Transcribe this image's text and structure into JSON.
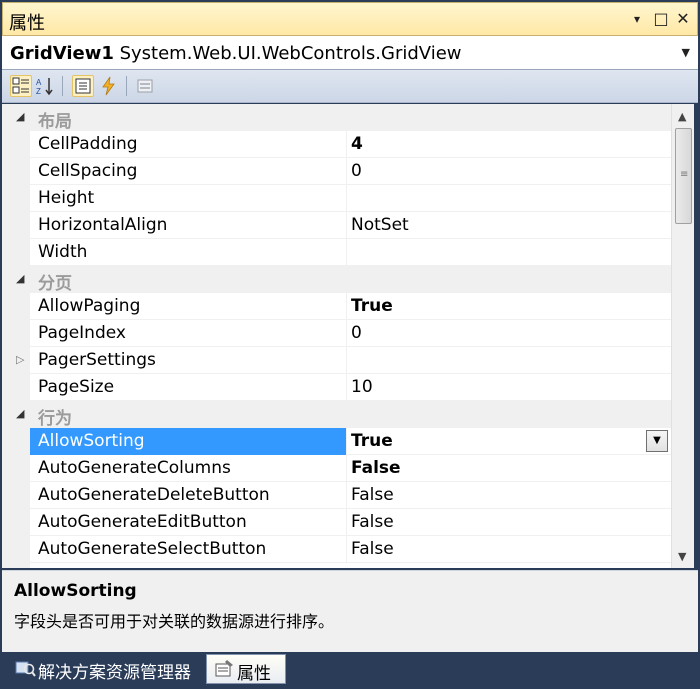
{
  "titlebar": {
    "title": "属性",
    "buttons": {
      "menu": "▾",
      "maximize": "□",
      "close": "✕"
    }
  },
  "object_selector": {
    "name": "GridView1",
    "type": "System.Web.UI.WebControls.GridView"
  },
  "toolbar": {
    "tools": [
      "categorized-icon",
      "alphabetical-icon",
      "properties-icon",
      "events-icon",
      "property-pages-icon"
    ]
  },
  "grid": {
    "categories": {
      "layout": "布局",
      "paging": "分页",
      "behavior": "行为"
    },
    "rows": [
      {
        "name": "CellPadding",
        "value": "4"
      },
      {
        "name": "CellSpacing",
        "value": "0"
      },
      {
        "name": "Height",
        "value": ""
      },
      {
        "name": "HorizontalAlign",
        "value": "NotSet"
      },
      {
        "name": "Width",
        "value": ""
      },
      {
        "name": "AllowPaging",
        "value": "True"
      },
      {
        "name": "PageIndex",
        "value": "0"
      },
      {
        "name": "PagerSettings",
        "value": ""
      },
      {
        "name": "PageSize",
        "value": "10"
      },
      {
        "name": "AllowSorting",
        "value": "True"
      },
      {
        "name": "AutoGenerateColumns",
        "value": "False"
      },
      {
        "name": "AutoGenerateDeleteButton",
        "value": "False"
      },
      {
        "name": "AutoGenerateEditButton",
        "value": "False"
      },
      {
        "name": "AutoGenerateSelectButton",
        "value": "False"
      }
    ]
  },
  "description": {
    "title": "AllowSorting",
    "text": "字段头是否可用于对关联的数据源进行排序。"
  },
  "tabs": {
    "solution_explorer": "解决方案资源管理器",
    "properties": "属性"
  },
  "colors": {
    "selection": "#3399ff",
    "frame": "#2b3c59",
    "titlebar": "#ffe8a6"
  }
}
